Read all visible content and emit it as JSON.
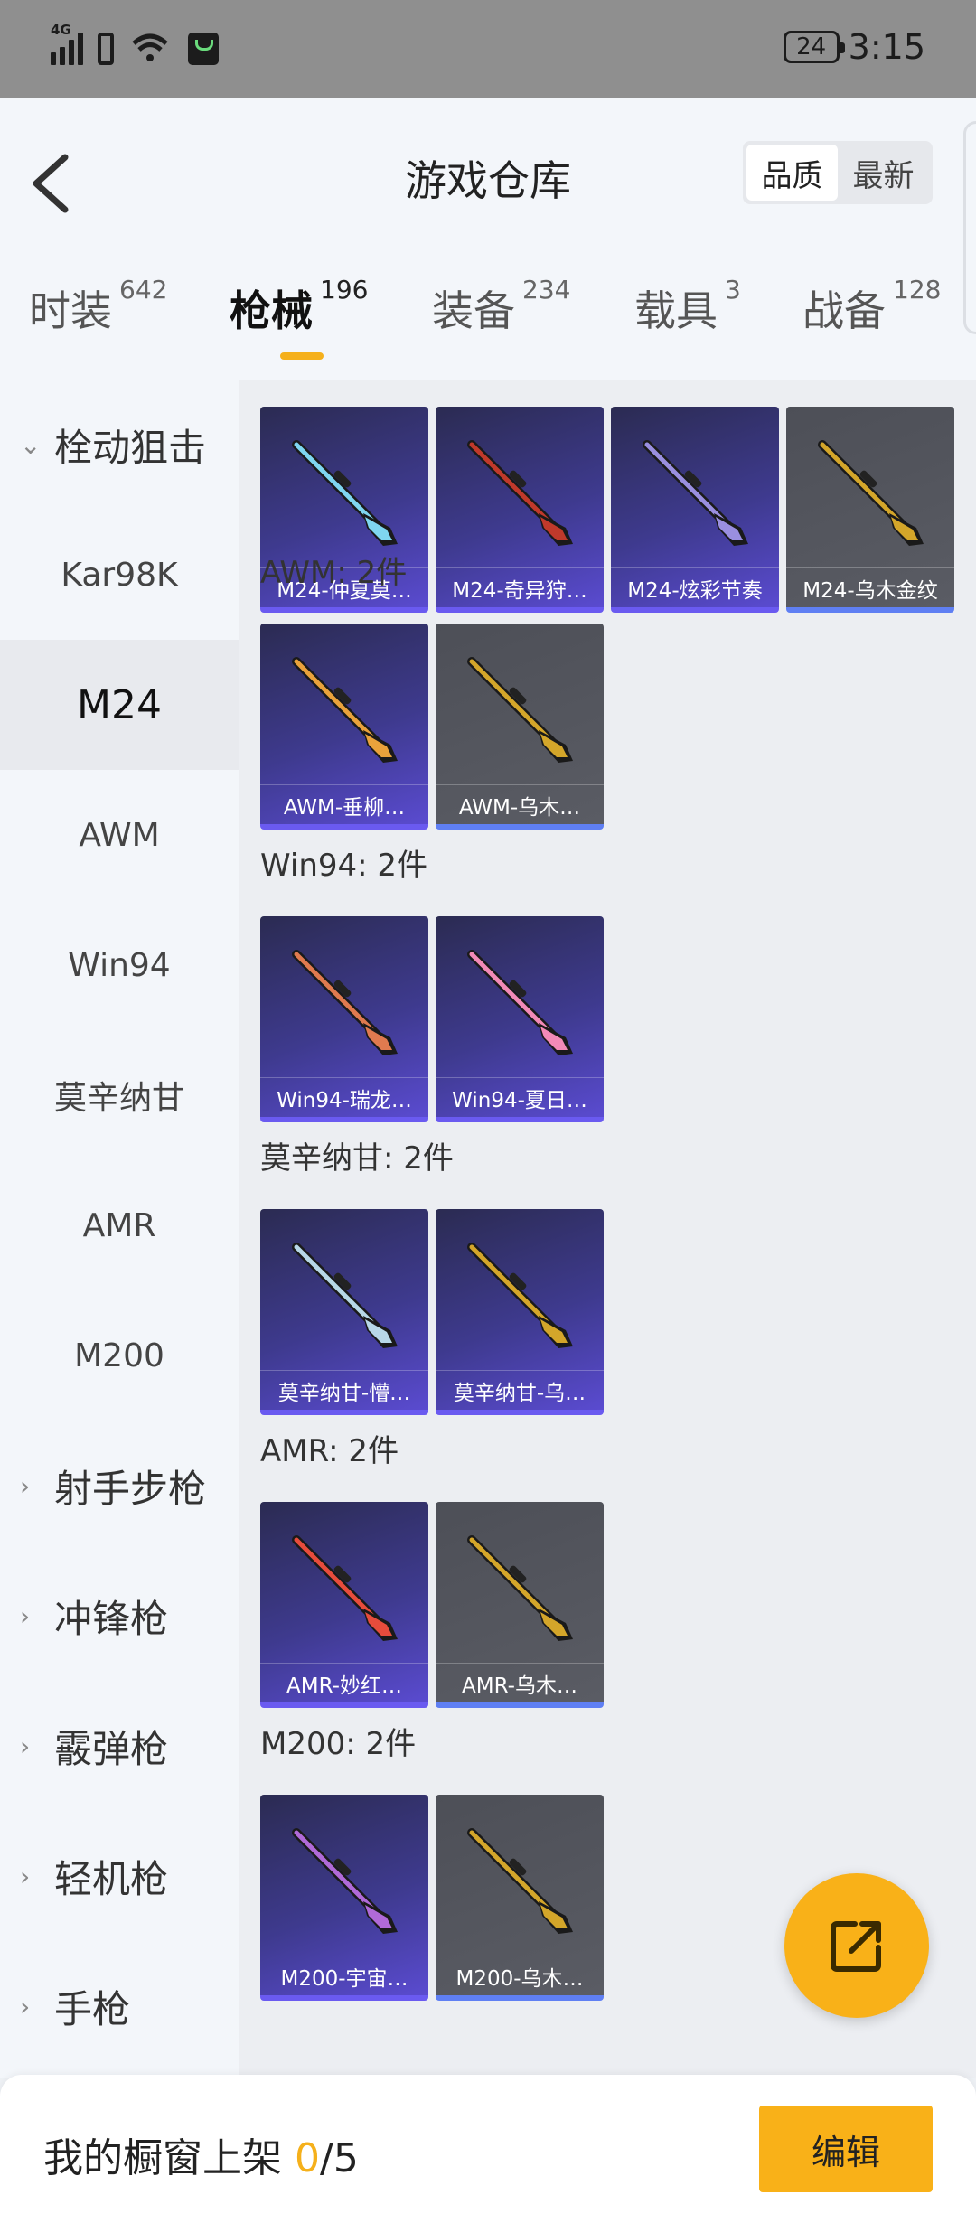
{
  "status_bar": {
    "network": "4G",
    "battery": "24",
    "time": "3:15"
  },
  "header": {
    "back_icon": "chevron-left-icon",
    "title": "游戏仓库",
    "sort_options": [
      "品质",
      "最新"
    ],
    "active_sort": "品质"
  },
  "tabs": [
    {
      "label": "时装",
      "count": "642"
    },
    {
      "label": "枪械",
      "count": "196",
      "active": true
    },
    {
      "label": "装备",
      "count": "234"
    },
    {
      "label": "载具",
      "count": "3"
    },
    {
      "label": "战备",
      "count": "128"
    }
  ],
  "sidebar": {
    "items": [
      {
        "label": "栓动狙击",
        "type": "group",
        "expanded": true
      },
      {
        "label": "Kar98K",
        "type": "sub"
      },
      {
        "label": "M24",
        "type": "sub",
        "active": true
      },
      {
        "label": "AWM",
        "type": "sub"
      },
      {
        "label": "Win94",
        "type": "sub"
      },
      {
        "label": "莫辛纳甘",
        "type": "sub"
      },
      {
        "label": "AMR",
        "type": "sub"
      },
      {
        "label": "M200",
        "type": "sub"
      },
      {
        "label": "射手步枪",
        "type": "group"
      },
      {
        "label": "冲锋枪",
        "type": "group"
      },
      {
        "label": "霰弹枪",
        "type": "group"
      },
      {
        "label": "轻机枪",
        "type": "group"
      },
      {
        "label": "手枪",
        "type": "group"
      }
    ]
  },
  "sections": [
    {
      "title": "",
      "items": [
        {
          "name": "M24-仲夏莫…",
          "tier": "purple",
          "color": "#7fd6f0"
        },
        {
          "name": "M24-奇异狩…",
          "tier": "purple",
          "color": "#c0392b"
        },
        {
          "name": "M24-炫彩节奏",
          "tier": "purple",
          "color": "#9a8fe0"
        },
        {
          "name": "M24-乌木金纹",
          "tier": "gray",
          "color": "#d4a62a"
        }
      ]
    },
    {
      "title": "AWM: 2件",
      "items": [
        {
          "name": "AWM-垂柳…",
          "tier": "purple",
          "color": "#e9a23b"
        },
        {
          "name": "AWM-乌木…",
          "tier": "gray",
          "color": "#d4a62a"
        }
      ]
    },
    {
      "title": "Win94: 2件",
      "items": [
        {
          "name": "Win94-瑞龙…",
          "tier": "purple",
          "color": "#e07a4f"
        },
        {
          "name": "Win94-夏日…",
          "tier": "purple",
          "color": "#f28ab8"
        }
      ]
    },
    {
      "title": "莫辛纳甘: 2件",
      "items": [
        {
          "name": "莫辛纳甘-懵…",
          "tier": "purple",
          "color": "#b8d8e8"
        },
        {
          "name": "莫辛纳甘-乌…",
          "tier": "purple",
          "color": "#d4a62a"
        }
      ]
    },
    {
      "title": "AMR: 2件",
      "items": [
        {
          "name": "AMR-妙红…",
          "tier": "purple",
          "color": "#e74c3c"
        },
        {
          "name": "AMR-乌木…",
          "tier": "gray",
          "color": "#d4a62a"
        }
      ]
    },
    {
      "title": "M200: 2件",
      "items": [
        {
          "name": "M200-宇宙…",
          "tier": "purple",
          "color": "#b06ad8"
        },
        {
          "name": "M200-乌木…",
          "tier": "gray",
          "color": "#d4a62a"
        }
      ]
    }
  ],
  "fab_icon": "share-icon",
  "bottom_bar": {
    "label": "我的橱窗上架",
    "count": "0",
    "total": "/5",
    "edit_label": "编辑"
  }
}
